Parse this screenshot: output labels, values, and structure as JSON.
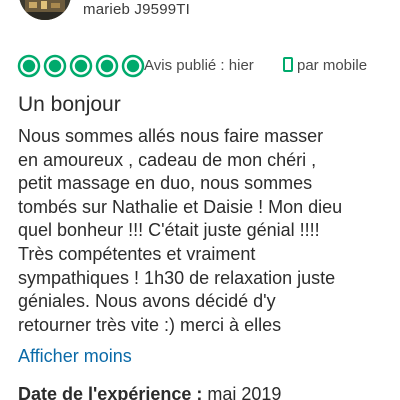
{
  "review": {
    "username": "marieb J9599TI",
    "rating": 5,
    "rating_max": 5,
    "published": "Avis publié : hier",
    "device": "par mobile",
    "title": "Un bonjour",
    "body_lines": [
      "Nous sommes allés nous faire masser",
      "en amoureux , cadeau de mon chéri ,",
      "petit massage en duo, nous sommes",
      "tombés sur Nathalie et Daisie ! Mon dieu",
      "quel bonheur !!! C'était juste génial !!!!",
      "Très compétentes et vraiment",
      "sympathiques ! 1h30 de relaxation juste",
      "géniales. Nous avons décidé d'y",
      "retourner très vite :) merci à elles"
    ],
    "toggle_label": "Afficher moins",
    "experience_label": "Date de l'expérience :",
    "experience_value": "mai 2019"
  },
  "colors": {
    "rating_green": "#00aa6c",
    "link_blue": "#0a6aa8"
  },
  "icons": {
    "avatar": "avatar-photo",
    "rating": "rating-bubble-icon",
    "device": "mobile-phone-icon"
  }
}
